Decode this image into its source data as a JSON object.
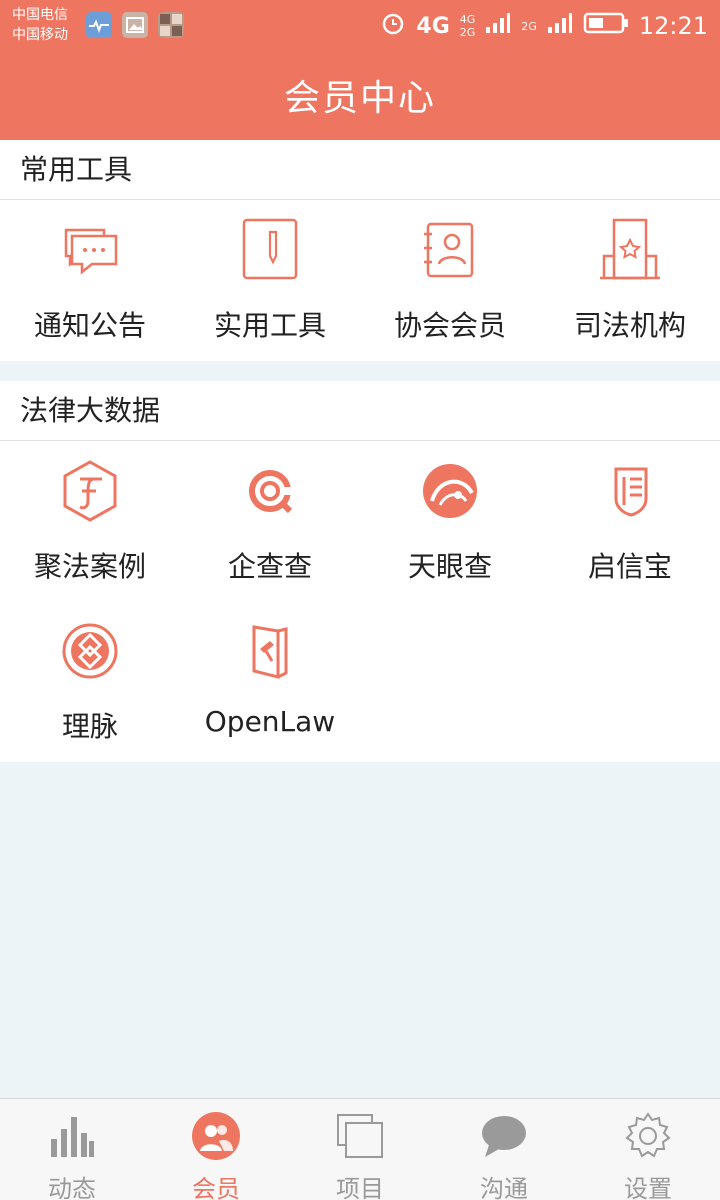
{
  "status_bar": {
    "carrier_1": "中国电信",
    "carrier_2": "中国移动",
    "network_1": "4G",
    "network_2a": "4G",
    "network_2b": "2G",
    "network_3": "2G",
    "time": "12:21",
    "icons": [
      "health-app-icon",
      "gallery-app-icon",
      "photo-grid-app-icon",
      "alarm-icon",
      "signal-icon",
      "battery-icon"
    ]
  },
  "header": {
    "title": "会员中心"
  },
  "sections": [
    {
      "title": "常用工具",
      "items": [
        {
          "label": "通知公告",
          "icon": "chat-bubbles-icon"
        },
        {
          "label": "实用工具",
          "icon": "notebook-pen-icon"
        },
        {
          "label": "协会会员",
          "icon": "contact-book-icon"
        },
        {
          "label": "司法机构",
          "icon": "building-star-icon"
        }
      ]
    },
    {
      "title": "法律大数据",
      "items": [
        {
          "label": "聚法案例",
          "icon": "jufa-logo-icon"
        },
        {
          "label": "企查查",
          "icon": "qichacha-logo-icon"
        },
        {
          "label": "天眼查",
          "icon": "tianyancha-logo-icon"
        },
        {
          "label": "启信宝",
          "icon": "qixinbao-logo-icon"
        },
        {
          "label": "理脉",
          "icon": "limai-logo-icon"
        },
        {
          "label": "OpenLaw",
          "icon": "openlaw-logo-icon"
        }
      ]
    }
  ],
  "tab_bar": {
    "active": "会员",
    "tabs": [
      {
        "label": "动态",
        "icon": "bar-chart-icon"
      },
      {
        "label": "会员",
        "icon": "members-icon"
      },
      {
        "label": "项目",
        "icon": "stacked-pages-icon"
      },
      {
        "label": "沟通",
        "icon": "chat-icon"
      },
      {
        "label": "设置",
        "icon": "gear-icon"
      }
    ]
  },
  "colors": {
    "accent": "#ee7560",
    "background": "#ecf4f7",
    "inactive": "#9a9a9a"
  }
}
